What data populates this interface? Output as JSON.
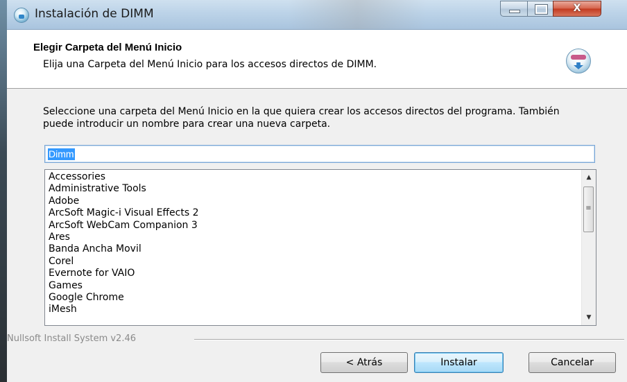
{
  "window": {
    "title": "Instalación de DIMM",
    "controls": {
      "minimize": "minimize",
      "maximize": "maximize",
      "close": "X"
    }
  },
  "header": {
    "title": "Elegir Carpeta del Menú Inicio",
    "subtitle": "Elija una Carpeta del Menú Inicio para los accesos directos de DIMM.",
    "icon": "nsis-installer-icon"
  },
  "body": {
    "description": "Seleccione una carpeta del Menú Inicio en la que quiera crear los accesos directos del programa. También puede introducir un nombre para crear una nueva carpeta.",
    "folder_input_value": "Dimm",
    "folder_list": [
      "Accessories",
      "Administrative Tools",
      "Adobe",
      "ArcSoft Magic-i Visual Effects 2",
      "ArcSoft WebCam Companion 3",
      "Ares",
      "Banda Ancha Movil",
      "Corel",
      "Evernote for VAIO",
      "Games",
      "Google Chrome",
      "iMesh"
    ]
  },
  "footer": {
    "branding": "Nullsoft Install System v2.46",
    "back_label": "< Atrás",
    "install_label": "Instalar",
    "cancel_label": "Cancelar"
  },
  "colors": {
    "selection": "#3399ff",
    "close_button": "#c2391f",
    "default_button_border": "#3c7fb1"
  }
}
